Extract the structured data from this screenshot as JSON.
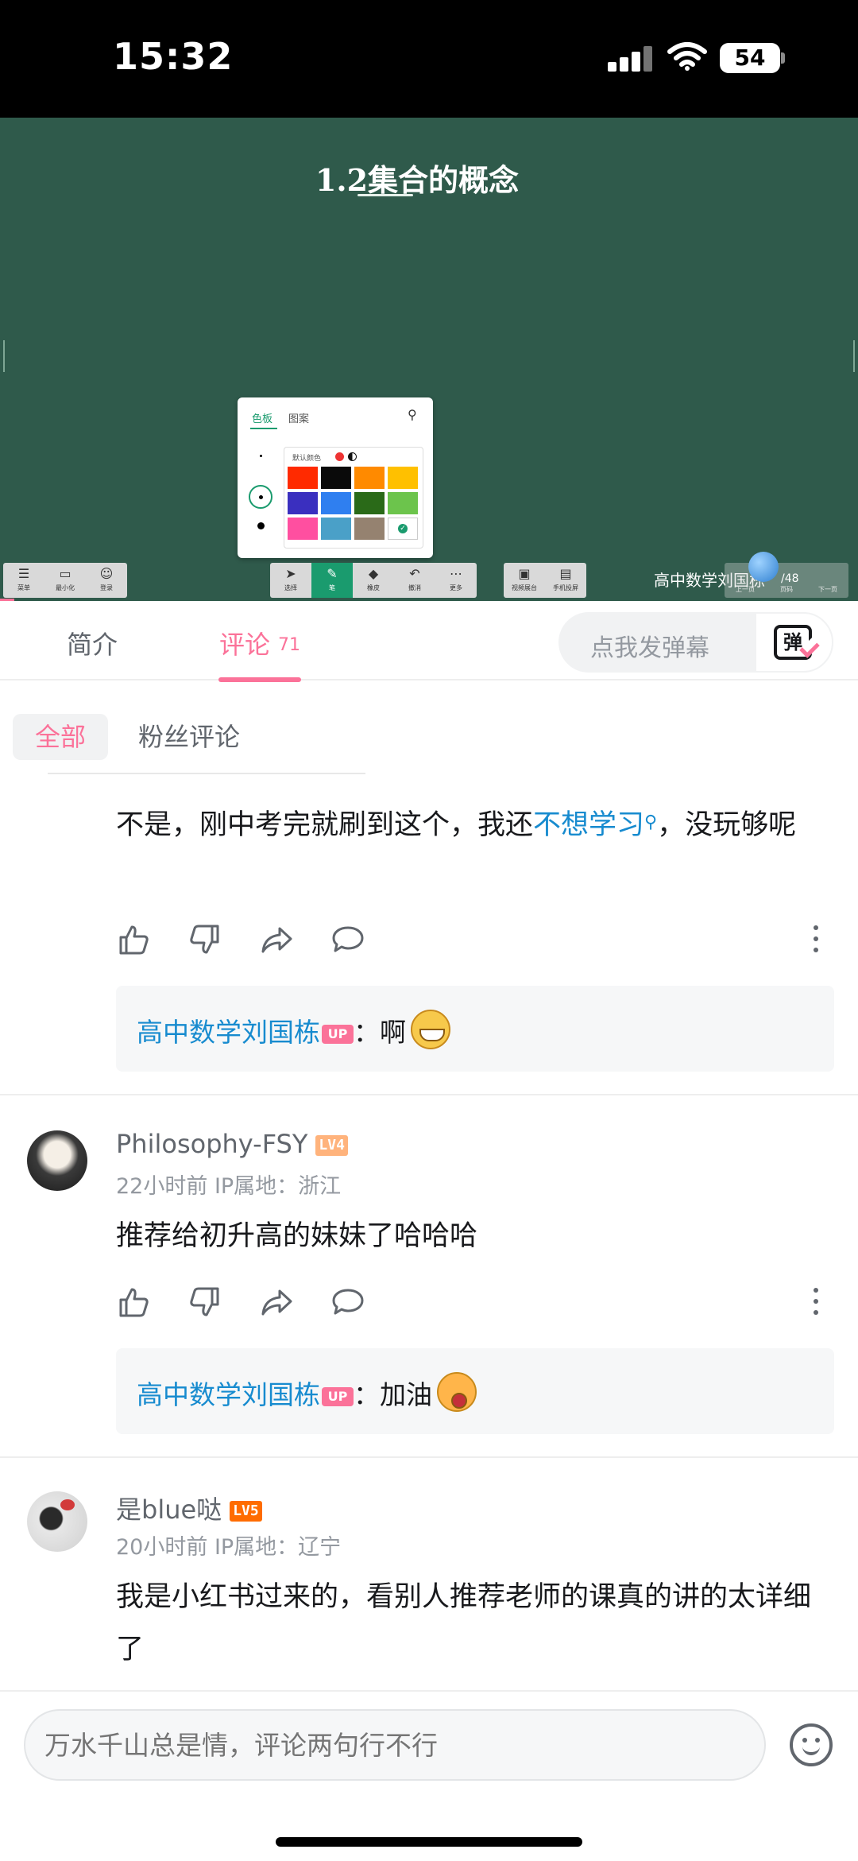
{
  "status_bar": {
    "time": "15:32",
    "battery": "54"
  },
  "video": {
    "title": "1.2集合的概念",
    "palette": {
      "tab_active": "色板",
      "tab_other": "图案",
      "default_color_label": "默认颜色"
    },
    "left_tools": [
      {
        "label": "菜单",
        "glyph": "☰"
      },
      {
        "label": "最小化",
        "glyph": "▭"
      },
      {
        "label": "登录",
        "glyph": "☺"
      }
    ],
    "center_tools": [
      {
        "label": "选择",
        "glyph": "➤",
        "active": false
      },
      {
        "label": "笔",
        "glyph": "✎",
        "active": true
      },
      {
        "label": "橡皮",
        "glyph": "◆",
        "active": false
      },
      {
        "label": "撤消",
        "glyph": "↶",
        "active": false
      },
      {
        "label": "更多",
        "glyph": "⋯",
        "active": false
      }
    ],
    "right_tools": [
      {
        "label": "视频展台",
        "glyph": "▣"
      },
      {
        "label": "手机投屏",
        "glyph": "▤"
      }
    ],
    "uploader_overlay": "高中数学刘国栋",
    "page_indicator": "/48",
    "nav_labels": [
      "上一页",
      "页码",
      "下一页"
    ]
  },
  "tabs": {
    "intro": "简介",
    "comments": "评论",
    "comment_count": "71",
    "danmaku_placeholder": "点我发弹幕",
    "danmaku_icon_text": "弹"
  },
  "filters": {
    "all": "全部",
    "fans": "粉丝评论"
  },
  "comments": [
    {
      "text_before": "不是，刚中考完就刷到这个，我还",
      "link": "不想学习",
      "text_after": "，没玩够呢",
      "reply": {
        "name": "高中数学刘国栋",
        "badge": "UP",
        "sep": "：",
        "text": "啊"
      }
    },
    {
      "user": "Philosophy-FSY",
      "level": "LV4",
      "meta": "22小时前  IP属地：浙江",
      "text": "推荐给初升高的妹妹了哈哈哈",
      "reply": {
        "name": "高中数学刘国栋",
        "badge": "UP",
        "sep": "：",
        "text": "加油"
      }
    },
    {
      "user": "是blue哒",
      "level": "LV5",
      "meta": "20小时前  IP属地：辽宁",
      "text": "我是小红书过来的，看别人推荐老师的课真的讲的太详细了"
    }
  ],
  "bottom_bar": {
    "placeholder": "万水千山总是情，评论两句行不行"
  },
  "colors": {
    "accent_pink": "#fb7299",
    "link_blue": "#178bcf",
    "board_green": "#2f5a4b",
    "swatches": [
      "#ff2a00",
      "#0a0a0a",
      "#ff8a00",
      "#ffc000",
      "#3a2fbf",
      "#2f7ff0",
      "#2a6a18",
      "#6cc44c",
      "#ff4fa0",
      "#4aa0c8",
      "#958270",
      "#ffffff"
    ]
  },
  "icons": [
    "signal-icon",
    "wifi-icon",
    "battery-icon",
    "pin-icon",
    "like-icon",
    "dislike-icon",
    "share-icon",
    "reply-icon",
    "more-icon",
    "emoji-icon"
  ]
}
